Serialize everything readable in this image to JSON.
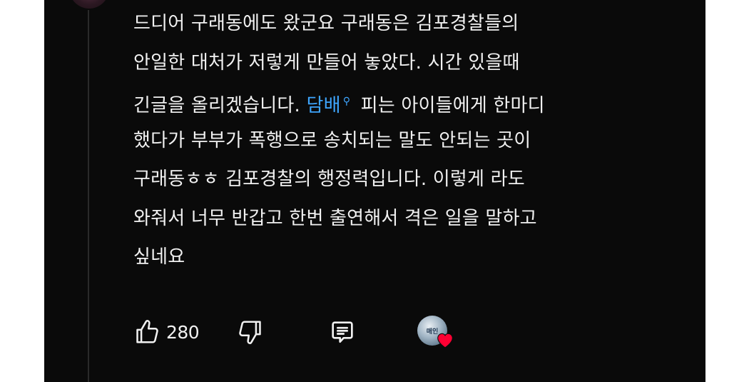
{
  "comment": {
    "lines": [
      {
        "text": "드디어 구래동에도 왔군요 구래동은 김포경찰들의"
      },
      {
        "text": "안일한 대처가 저렇게 만들어 놓았다. 시간 있을때"
      },
      {
        "before": "긴글을 올리겠습니다. ",
        "link": "담배",
        "after": " 피는 아이들에게 한마디"
      },
      {
        "text": "했다가 부부가 폭행으로 송치되는 말도 안되는 곳이"
      },
      {
        "text": "구래동ㅎㅎ 김포경찰의 행정력입니다. 이렇게 라도"
      },
      {
        "text": "와줘서 너무 반갑고 한번 출연해서 격은 일을 말하고"
      },
      {
        "text": "싶네요"
      }
    ]
  },
  "actions": {
    "like_count": "280",
    "creator_avatar_text": "매인"
  },
  "colors": {
    "background": "#0a0a0a",
    "text": "#f1f1f1",
    "link": "#3ea6ff",
    "heart": "#ff0033"
  }
}
